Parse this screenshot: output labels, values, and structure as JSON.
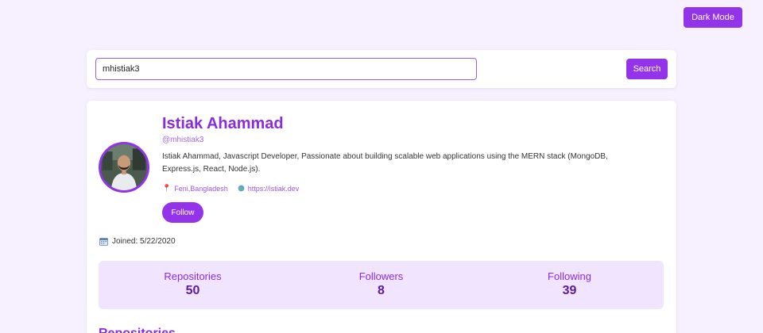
{
  "header": {
    "dark_mode_label": "Dark Mode"
  },
  "search": {
    "value": "mhistiak3",
    "button_label": "Search"
  },
  "profile": {
    "name": "Istiak Ahammad",
    "username": "@mhistiak3",
    "bio": "Istiak Ahammad,   Javascript Developer,  Passionate about building scalable web applications using the MERN stack (MongoDB, Express.js, React, Node.js).",
    "location": "Feni,Bangladesh",
    "website": "https://istiak.dev",
    "follow_label": "Follow",
    "joined": "Joined: 5/22/2020"
  },
  "stats": [
    {
      "label": "Repositories",
      "value": "50"
    },
    {
      "label": "Followers",
      "value": "8"
    },
    {
      "label": "Following",
      "value": "39"
    }
  ],
  "sections": {
    "repositories_title": "Repositories"
  },
  "colors": {
    "accent": "#9333ea",
    "heading": "#8b2be0",
    "background": "#f7f1ff",
    "stats_background": "#f1e4ff"
  },
  "icons": {
    "location": "map-pin-icon",
    "website": "globe-icon",
    "joined": "calendar-icon"
  }
}
